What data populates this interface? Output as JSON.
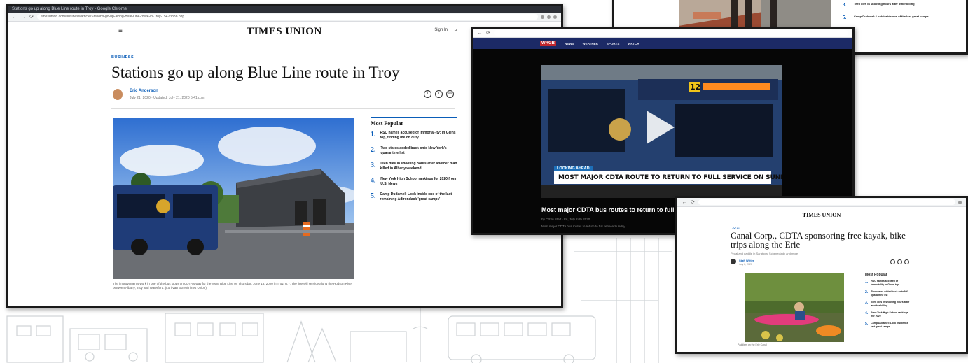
{
  "window_times_union": {
    "tab_title": "Stations go up along Blue Line route in Troy - Google Chrome",
    "url": "timesunion.com/business/article/Stations-go-up-along-Blue-Line-route-in-Troy-15423838.php",
    "logo": "TIMES UNION",
    "menu_icon": "≡",
    "signin": "Sign In",
    "section": "BUSINESS",
    "headline": "Stations go up along Blue Line route in Troy",
    "author": "Eric Anderson",
    "date": "July 21, 2020 · Updated: July 21, 2020 5:41 p.m.",
    "share_icons": [
      "facebook-icon",
      "twitter-icon",
      "email-icon"
    ],
    "caption": "The improvements work in one of the bus stops on CDTA's way for the route Blue Line on Thursday, June 18, 2020 in Troy, N.Y. The line will service along the Hudson River between Albany, Troy and Waterford. (Lori Van Buren/Times Union)",
    "most_popular": {
      "title": "Most Popular",
      "items": [
        {
          "num": "1.",
          "text": "RSC names accused of immortal-ity: in Glens top, finding me on duty"
        },
        {
          "num": "2.",
          "text": "Two states added back onto New York's quarantine list"
        },
        {
          "num": "3.",
          "text": "Teen dies in shooting hours after another man killed in Albany weekend"
        },
        {
          "num": "4.",
          "text": "New York High School rankings for 2020 from U.S. News"
        },
        {
          "num": "5.",
          "text": "Camp Dudamel: Look inside one of the last remaining Adirondack 'great camps'"
        }
      ]
    }
  },
  "window_video": {
    "nav_logo": "WRGB",
    "nav_items": [
      "NEWS",
      "WEATHER",
      "SPORTS",
      "WATCH"
    ],
    "lower_tag": "LOOKING AHEAD",
    "lower_third": "MOST MAJOR CDTA ROUTE TO RETURN TO FULL SERVICE ON SUNDAY",
    "bus_number": "12",
    "headline": "Most major CDTA bus routes to return to full service",
    "meta": "by CBS6 Staff · Fri, July 24th 2020",
    "meta2": "Most major CDTA bus routes to return to full service Sunday"
  },
  "window_topright": {
    "popular_items": [
      {
        "num": "3.",
        "text": "Teen dies in shooting hours after other killing"
      },
      {
        "num": "5.",
        "text": "Camp Dudamel: Look inside one of the last great camps"
      }
    ]
  },
  "window_canal": {
    "logo": "TIMES UNION",
    "section": "LOCAL",
    "headline": "Canal Corp., CDTA sponsoring free kayak, bike trips along the Erie",
    "sub": "Pedal and paddle in Saratoga, Schenectady and more",
    "author": "Staff Writer",
    "date": "July 8, 2020",
    "caption": "Paddlers on the Erie Canal",
    "most_popular": {
      "title": "Most Popular",
      "items": [
        {
          "num": "1.",
          "text": "RSC names accused of immortality in Glens top"
        },
        {
          "num": "2.",
          "text": "Two states added back onto NY quarantine list"
        },
        {
          "num": "3.",
          "text": "Teen dies in shooting hours after another killing"
        },
        {
          "num": "4.",
          "text": "New York High School rankings for 2020"
        },
        {
          "num": "5.",
          "text": "Camp Dudamel: Look inside the last great camps"
        }
      ]
    }
  },
  "colors": {
    "accent_blue": "#0a5db8",
    "tv_nav": "#1c2a66",
    "window_border": "#1a1a1a"
  }
}
